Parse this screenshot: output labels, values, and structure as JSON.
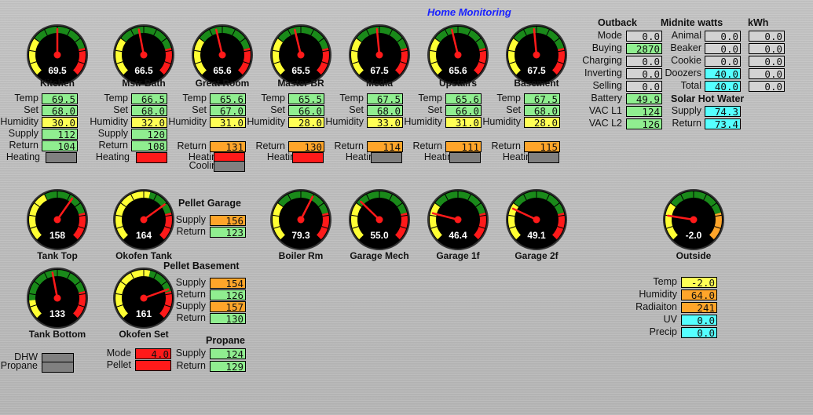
{
  "title": "Home Monitoring",
  "colors": {
    "green": "#90ee90",
    "yellow": "#ffff55",
    "orange": "#ffa52a",
    "red": "#ff1a1a",
    "gray": "#808080",
    "lightgray": "#d3d3d3",
    "cyan": "#55ffff",
    "title": "#1a22ff"
  },
  "gauges": [
    {
      "id": "kitchen",
      "name": "Kitchen",
      "value": "69.5",
      "needle": 0.5,
      "scheme": "temp"
    },
    {
      "id": "mstr-bath",
      "name": "Mstr Bath",
      "value": "66.5",
      "needle": 0.46,
      "scheme": "temp"
    },
    {
      "id": "great-room",
      "name": "Great Room",
      "value": "65.6",
      "needle": 0.45,
      "scheme": "temp"
    },
    {
      "id": "master-br",
      "name": "Master BR",
      "value": "65.5",
      "needle": 0.45,
      "scheme": "temp"
    },
    {
      "id": "media",
      "name": "Media",
      "value": "67.5",
      "needle": 0.48,
      "scheme": "temp"
    },
    {
      "id": "upstairs",
      "name": "Upstairs",
      "value": "65.6",
      "needle": 0.45,
      "scheme": "temp"
    },
    {
      "id": "basement",
      "name": "Basement",
      "value": "67.5",
      "needle": 0.48,
      "scheme": "temp"
    },
    {
      "id": "tank-top",
      "name": "Tank Top",
      "value": "158",
      "needle": 0.63,
      "scheme": "tank"
    },
    {
      "id": "okofen-tank",
      "name": "Okofen Tank",
      "value": "164",
      "needle": 0.7,
      "scheme": "okofen"
    },
    {
      "id": "boiler-rm",
      "name": "Boiler Rm",
      "value": "79.3",
      "needle": 0.6,
      "scheme": "temp"
    },
    {
      "id": "garage-mech",
      "name": "Garage Mech",
      "value": "55.0",
      "needle": 0.33,
      "scheme": "temp"
    },
    {
      "id": "garage-1f",
      "name": "Garage 1f",
      "value": "46.4",
      "needle": 0.22,
      "scheme": "temp"
    },
    {
      "id": "garage-2f",
      "name": "Garage 2f",
      "value": "49.1",
      "needle": 0.26,
      "scheme": "temp"
    },
    {
      "id": "outside",
      "name": "Outside",
      "value": "-2.0",
      "needle": 0.2,
      "scheme": "outside"
    },
    {
      "id": "tank-bottom",
      "name": "Tank Bottom",
      "value": "133",
      "needle": 0.46,
      "scheme": "tankbottom"
    },
    {
      "id": "okofen-set",
      "name": "Okofen Set",
      "value": "161",
      "needle": 0.76,
      "scheme": "okofen"
    }
  ],
  "zones": [
    {
      "name": "Kitchen",
      "rows": [
        {
          "label": "Temp",
          "value": "69.5",
          "color": "green"
        },
        {
          "label": "Set",
          "value": "68.0",
          "color": "green"
        },
        {
          "label": "Humidity",
          "value": "30.0",
          "color": "yellow"
        },
        {
          "label": "Supply",
          "value": "112",
          "color": "green"
        },
        {
          "label": "Return",
          "value": "104",
          "color": "green"
        },
        {
          "label": "Heating",
          "value": "",
          "color": "gray"
        }
      ]
    },
    {
      "name": "Mstr Bath",
      "rows": [
        {
          "label": "Temp",
          "value": "66.5",
          "color": "green"
        },
        {
          "label": "Set",
          "value": "68.0",
          "color": "green"
        },
        {
          "label": "Humidity",
          "value": "32.0",
          "color": "yellow"
        },
        {
          "label": "Supply",
          "value": "120",
          "color": "green"
        },
        {
          "label": "Return",
          "value": "108",
          "color": "green"
        },
        {
          "label": "Heating",
          "value": "",
          "color": "red"
        }
      ]
    },
    {
      "name": "Great Room",
      "rows": [
        {
          "label": "Temp",
          "value": "65.6",
          "color": "green"
        },
        {
          "label": "Set",
          "value": "67.0",
          "color": "green"
        },
        {
          "label": "Humidity",
          "value": "31.0",
          "color": "yellow"
        },
        {
          "label": "Return",
          "value": "131",
          "color": "orange"
        },
        {
          "label": "Heating",
          "value": "",
          "color": "red"
        },
        {
          "label": "Cooling",
          "value": "",
          "color": "gray"
        }
      ]
    },
    {
      "name": "Master BR",
      "rows": [
        {
          "label": "Temp",
          "value": "65.5",
          "color": "green"
        },
        {
          "label": "Set",
          "value": "66.0",
          "color": "green"
        },
        {
          "label": "Humidity",
          "value": "28.0",
          "color": "yellow"
        },
        {
          "label": "Return",
          "value": "130",
          "color": "orange"
        },
        {
          "label": "Heating",
          "value": "",
          "color": "red"
        }
      ]
    },
    {
      "name": "Media",
      "rows": [
        {
          "label": "Temp",
          "value": "67.5",
          "color": "green"
        },
        {
          "label": "Set",
          "value": "68.0",
          "color": "green"
        },
        {
          "label": "Humidity",
          "value": "33.0",
          "color": "yellow"
        },
        {
          "label": "Return",
          "value": "114",
          "color": "orange"
        },
        {
          "label": "Heating",
          "value": "",
          "color": "gray"
        }
      ]
    },
    {
      "name": "Upstairs",
      "rows": [
        {
          "label": "Temp",
          "value": "65.6",
          "color": "green"
        },
        {
          "label": "Set",
          "value": "66.0",
          "color": "green"
        },
        {
          "label": "Humidity",
          "value": "31.0",
          "color": "yellow"
        },
        {
          "label": "Return",
          "value": "111",
          "color": "orange"
        },
        {
          "label": "Heating",
          "value": "",
          "color": "gray"
        }
      ]
    },
    {
      "name": "Basement",
      "rows": [
        {
          "label": "Temp",
          "value": "67.5",
          "color": "green"
        },
        {
          "label": "Set",
          "value": "68.0",
          "color": "green"
        },
        {
          "label": "Humidity",
          "value": "28.0",
          "color": "yellow"
        },
        {
          "label": "Return",
          "value": "115",
          "color": "orange"
        },
        {
          "label": "Heating",
          "value": "",
          "color": "gray"
        }
      ]
    }
  ],
  "outback": {
    "header": "Outback",
    "rows": [
      {
        "label": "Mode",
        "value": "0.0",
        "color": "lgray"
      },
      {
        "label": "Buying",
        "value": "2870",
        "color": "green"
      },
      {
        "label": "Charging",
        "value": "0.0",
        "color": "lgray"
      },
      {
        "label": "Inverting",
        "value": "0.0",
        "color": "lgray"
      },
      {
        "label": "Selling",
        "value": "0.0",
        "color": "lgray"
      },
      {
        "label": "Battery",
        "value": "49.9",
        "color": "green"
      },
      {
        "label": "VAC L1",
        "value": "124",
        "color": "green"
      },
      {
        "label": "VAC L2",
        "value": "126",
        "color": "green"
      }
    ]
  },
  "midnite": {
    "header": "Midnite watts",
    "kwh_header": "kWh",
    "rows": [
      {
        "label": "Animal",
        "watts": "0.0",
        "watts_color": "lgray",
        "kwh": "0.0"
      },
      {
        "label": "Beaker",
        "watts": "0.0",
        "watts_color": "lgray",
        "kwh": "0.0"
      },
      {
        "label": "Cookie",
        "watts": "0.0",
        "watts_color": "lgray",
        "kwh": "0.0"
      },
      {
        "label": "Doozers",
        "watts": "40.0",
        "watts_color": "cyan",
        "kwh": "0.0"
      },
      {
        "label": "Total",
        "watts": "40.0",
        "watts_color": "cyan",
        "kwh": "0.0"
      }
    ]
  },
  "solar_hot_water": {
    "header": "Solar Hot Water",
    "rows": [
      {
        "label": "Supply",
        "value": "74.3",
        "color": "cyan"
      },
      {
        "label": "Return",
        "value": "73.4",
        "color": "cyan"
      }
    ]
  },
  "pellet_garage": {
    "header": "Pellet Garage",
    "rows": [
      {
        "label": "Supply",
        "value": "156",
        "color": "orange"
      },
      {
        "label": "Return",
        "value": "123",
        "color": "green"
      }
    ]
  },
  "pellet_basement": {
    "header": "Pellet Basement",
    "rows": [
      {
        "label": "Supply",
        "value": "154",
        "color": "orange"
      },
      {
        "label": "Return",
        "value": "126",
        "color": "green"
      },
      {
        "label": "Supply",
        "value": "157",
        "color": "orange"
      },
      {
        "label": "Return",
        "value": "130",
        "color": "green"
      }
    ]
  },
  "propane": {
    "header": "Propane",
    "rows": [
      {
        "label": "Supply",
        "value": "124",
        "color": "green"
      },
      {
        "label": "Return",
        "value": "129",
        "color": "green"
      }
    ]
  },
  "okofen_status": {
    "rows": [
      {
        "label": "Mode",
        "value": "4.0",
        "color": "red"
      },
      {
        "label": "Pellet",
        "value": "",
        "color": "red"
      }
    ]
  },
  "dhw": {
    "rows": [
      {
        "label": "DHW",
        "value": "",
        "color": "gray"
      },
      {
        "label": "Propane",
        "value": "",
        "color": "gray"
      }
    ]
  },
  "weather": {
    "rows": [
      {
        "label": "Temp",
        "value": "-2.0",
        "color": "yellow"
      },
      {
        "label": "Humidity",
        "value": "64.0",
        "color": "orange"
      },
      {
        "label": "Radiaiton",
        "value": "241",
        "color": "orange"
      },
      {
        "label": "UV",
        "value": "0.0",
        "color": "cyan"
      },
      {
        "label": "Precip",
        "value": "0.0",
        "color": "cyan"
      }
    ]
  }
}
